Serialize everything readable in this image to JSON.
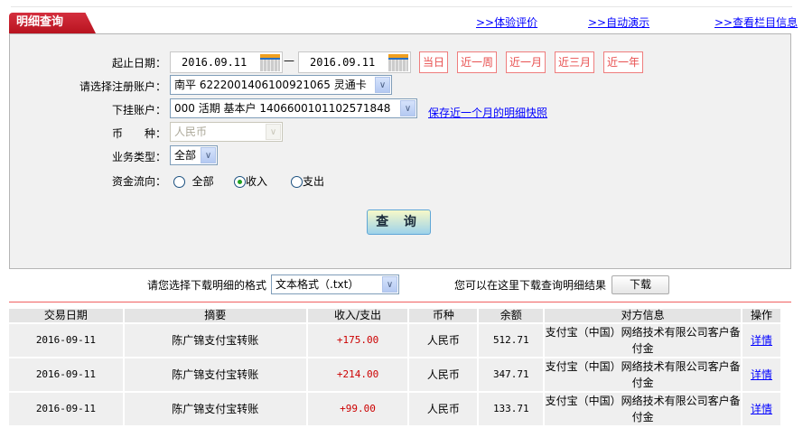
{
  "tab_title": "明细查询",
  "top_links": [
    ">>体验评价",
    ">>自动演示",
    ">>查看栏目信息"
  ],
  "form": {
    "date_label": "起止日期：",
    "start_date": "2016.09.11",
    "date_sep": "—",
    "end_date": "2016.09.11",
    "quick_ranges": [
      "当日",
      "近一周",
      "近一月",
      "近三月",
      "近一年"
    ],
    "account_label": "请选择注册账户：",
    "account_value": "南平 6222001406100921065 灵通卡",
    "sub_account_label": "下挂账户：",
    "sub_account_value": "000 活期 基本户 1406600101102571848",
    "snapshot_link": "保存近一个月的明细快照",
    "currency_label": "币　　种：",
    "currency_value": "人民币",
    "biz_type_label": "业务类型：",
    "biz_type_value": "全部",
    "flow_label": "资金流向：",
    "flow_options": [
      "全部",
      "收入",
      "支出"
    ],
    "flow_selected": "收入",
    "query_button": "查 询"
  },
  "download": {
    "format_label": "请您选择下载明细的格式",
    "format_value": "文本格式（.txt）",
    "hint": "您可以在这里下载查询明细结果",
    "button": "下载"
  },
  "table": {
    "headers": [
      "交易日期",
      "摘要",
      "收入/支出",
      "币种",
      "余额",
      "对方信息",
      "操作"
    ],
    "rows": [
      [
        "2016-09-11",
        "陈广锦支付宝转账",
        "+175.00",
        "人民币",
        "512.71",
        "支付宝（中国）网络技术有限公司客户备付金",
        "详情"
      ],
      [
        "2016-09-11",
        "陈广锦支付宝转账",
        "+214.00",
        "人民币",
        "347.71",
        "支付宝（中国）网络技术有限公司客户备付金",
        "详情"
      ],
      [
        "2016-09-11",
        "陈广锦支付宝转账",
        "+99.00",
        "人民币",
        "133.71",
        "支付宝（中国）网络技术有限公司客户备付金",
        "详情"
      ]
    ]
  },
  "colors": {
    "tab_red": "#c41e2c",
    "link_blue": "#0000ff",
    "amount_red": "#cc0000",
    "quick_btn": "#ef7d7d"
  }
}
